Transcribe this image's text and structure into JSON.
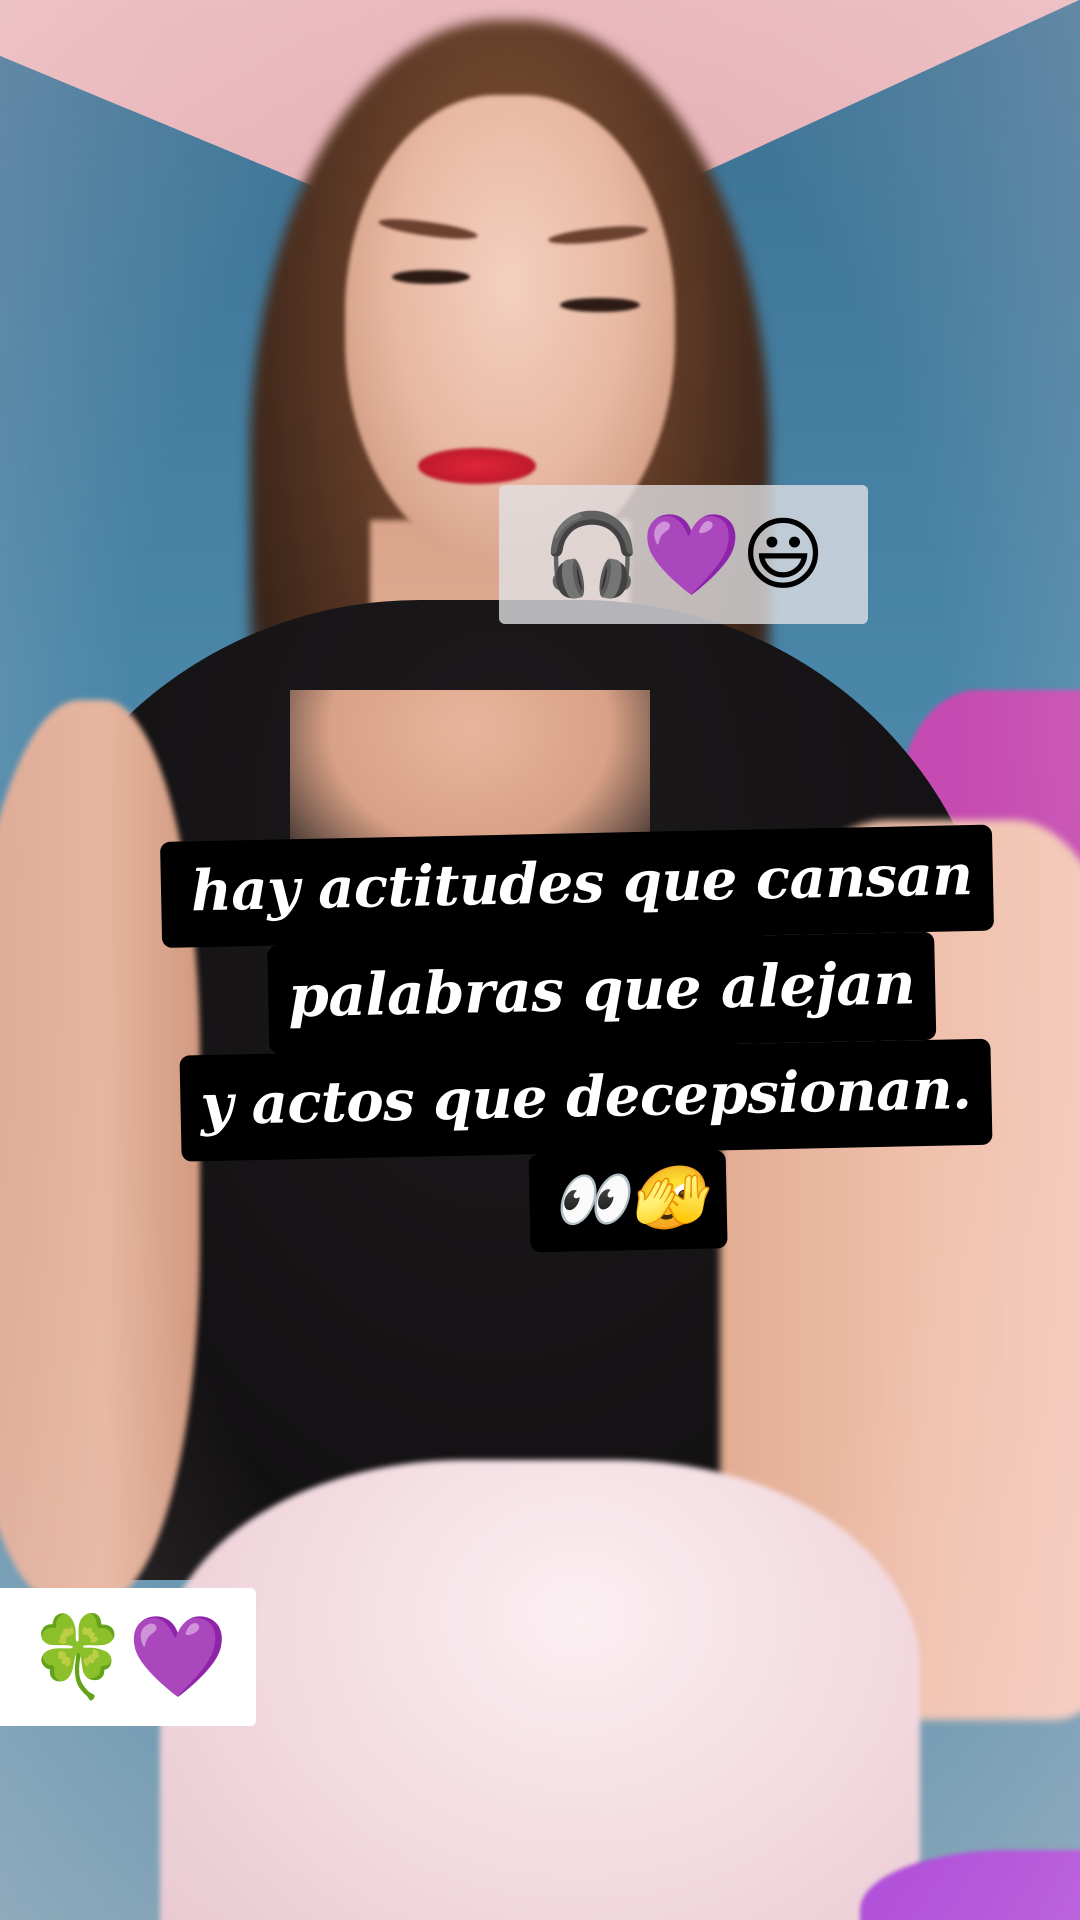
{
  "stickers": {
    "top": {
      "emojis": [
        "🎧",
        "💜",
        "😃"
      ],
      "icon_names": [
        "headphones-icon",
        "purple-heart-icon",
        "grinning-face-icon"
      ]
    },
    "bottom": {
      "emojis": [
        "🍀",
        "💜"
      ],
      "icon_names": [
        "four-leaf-clover-icon",
        "purple-heart-icon"
      ]
    }
  },
  "caption": {
    "lines": [
      "hay actitudes que cansan",
      "palabras que alejan",
      "y actos que decepsionan.",
      "👀🫣"
    ],
    "text_color": "#ffffff",
    "background_color": "#000000"
  }
}
